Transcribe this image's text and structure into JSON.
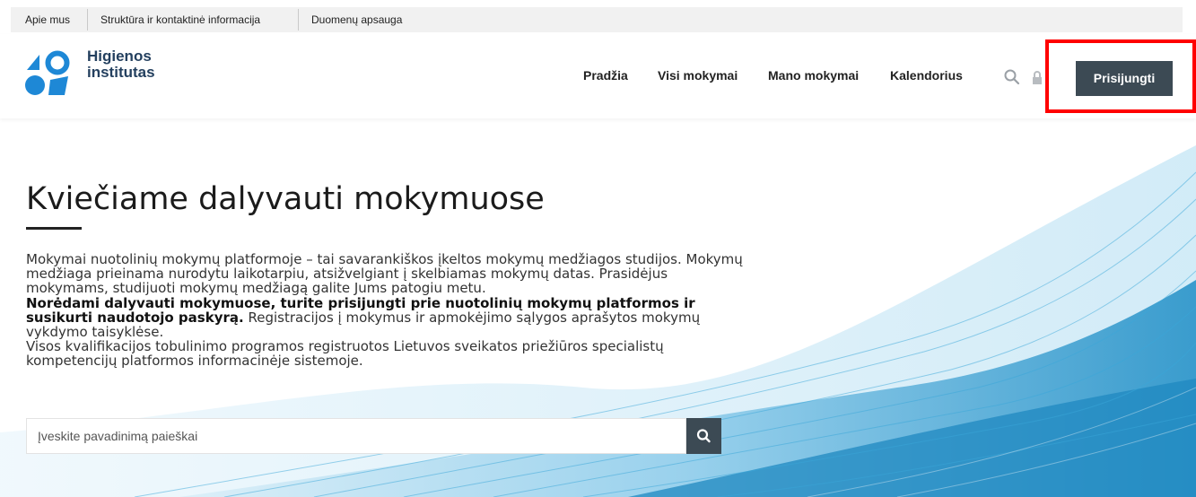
{
  "top_links": {
    "about": "Apie mus",
    "structure": "Struktūra ir kontaktinė informacija",
    "privacy": "Duomenų apsauga"
  },
  "brand": {
    "line1": "Higienos",
    "line2": "institutas",
    "color_primary": "#1e88d6",
    "color_text": "#24405f"
  },
  "nav": {
    "home": "Pradžia",
    "all_courses": "Visi mokymai",
    "my_courses": "Mano mokymai",
    "calendar": "Kalendorius"
  },
  "icons": {
    "search": "search-icon",
    "lock": "lock-icon"
  },
  "login_button": "Prisijungti",
  "hero": {
    "title": "Kviečiame dalyvauti mokymuose",
    "para1": "Mokymai nuotolinių mokymų platformoje – tai savarankiškos įkeltos mokymų medžiagos studijos. Mokymų medžiaga prieinama nurodytu laikotarpiu, atsižvelgiant į skelbiamas mokymų datas. Prasidėjus mokymams, studijuoti mokymų medžiagą galite Jums patogiu metu.",
    "para2_bold": "Norėdami dalyvauti mokymuose, turite prisijungti prie nuotolinių mokymų platformos ir susikurti naudotojo paskyrą.",
    "para2_rest": " Registracijos į mokymus ir apmokėjimo sąlygos aprašytos mokymų vykdymo taisyklėse.",
    "para3": "Visos kvalifikacijos tobulinimo programos registruotos Lietuvos sveikatos priežiūros specialistų kompetencijų platformos informacinėje sistemoje."
  },
  "search": {
    "placeholder": "Įveskite pavadinimą paieškai"
  },
  "colors": {
    "button": "#3c4a54",
    "highlight": "#ff0000",
    "wave": "#3aa7d9"
  }
}
